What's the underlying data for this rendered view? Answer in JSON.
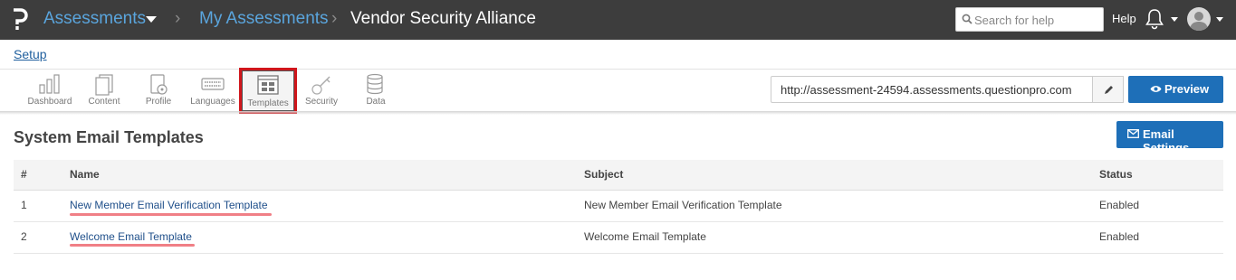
{
  "topbar": {
    "app_title": "Assessments",
    "sub_crumb": "My Assessments",
    "current_crumb": "Vendor Security Alliance",
    "separator": "›",
    "search_placeholder": "Search for help",
    "help_label": "Help"
  },
  "setup_link": "Setup",
  "toolbar": {
    "items": [
      {
        "label": "Dashboard",
        "icon": "bar-chart-icon"
      },
      {
        "label": "Content",
        "icon": "document-icon"
      },
      {
        "label": "Profile",
        "icon": "profile-icon"
      },
      {
        "label": "Languages",
        "icon": "keyboard-icon"
      },
      {
        "label": "Templates",
        "icon": "template-grid-icon",
        "active": true
      },
      {
        "label": "Security",
        "icon": "key-icon"
      },
      {
        "label": "Data",
        "icon": "database-icon"
      }
    ],
    "url_value": "http://assessment-24594.assessments.questionpro.com",
    "preview_label": "Preview"
  },
  "main": {
    "title": "System Email Templates",
    "email_settings_label": "Email Settings",
    "table": {
      "headers": {
        "num": "#",
        "name": "Name",
        "subject": "Subject",
        "status": "Status"
      },
      "rows": [
        {
          "num": "1",
          "name": "New Member Email Verification Template",
          "subject": "New Member Email Verification Template",
          "status": "Enabled"
        },
        {
          "num": "2",
          "name": "Welcome Email Template",
          "subject": "Welcome Email Template",
          "status": "Enabled"
        }
      ]
    }
  },
  "colors": {
    "topbar_bg": "#3d3d3d",
    "link_blue": "#5aa5dd",
    "button_blue": "#1e6fb8",
    "highlight_red": "#d0161c",
    "underline_pink": "#f07f86"
  }
}
